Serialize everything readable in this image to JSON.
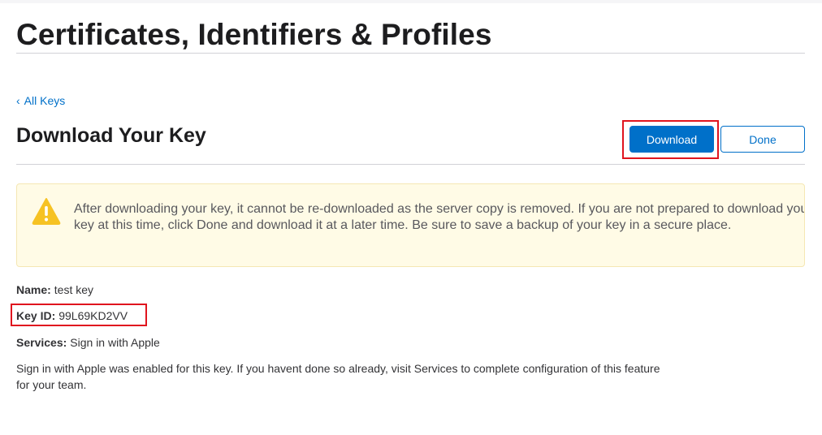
{
  "header": {
    "title": "Certificates, Identifiers & Profiles"
  },
  "nav": {
    "back_chevron": "‹",
    "back_label": "All Keys"
  },
  "section": {
    "title": "Download Your Key"
  },
  "actions": {
    "download_label": "Download",
    "done_label": "Done",
    "accent_color": "#0070c9",
    "highlight_color": "#e0141e"
  },
  "warning": {
    "icon": "warning-triangle-icon",
    "text": "After downloading your key, it cannot be re-downloaded as the server copy is removed. If you are not prepared to download your key at this time, click Done and download it at a later time. Be sure to save a backup of your key in a secure place."
  },
  "key": {
    "name_label": "Name:",
    "name_value": "test key",
    "id_label": "Key ID:",
    "id_value": "99L69KD2VV",
    "services_label": "Services:",
    "services_value": "Sign in with Apple"
  },
  "info": {
    "text": "Sign in with Apple was enabled for this key. If you havent done so already, visit Services to complete configuration of this feature for your team."
  }
}
